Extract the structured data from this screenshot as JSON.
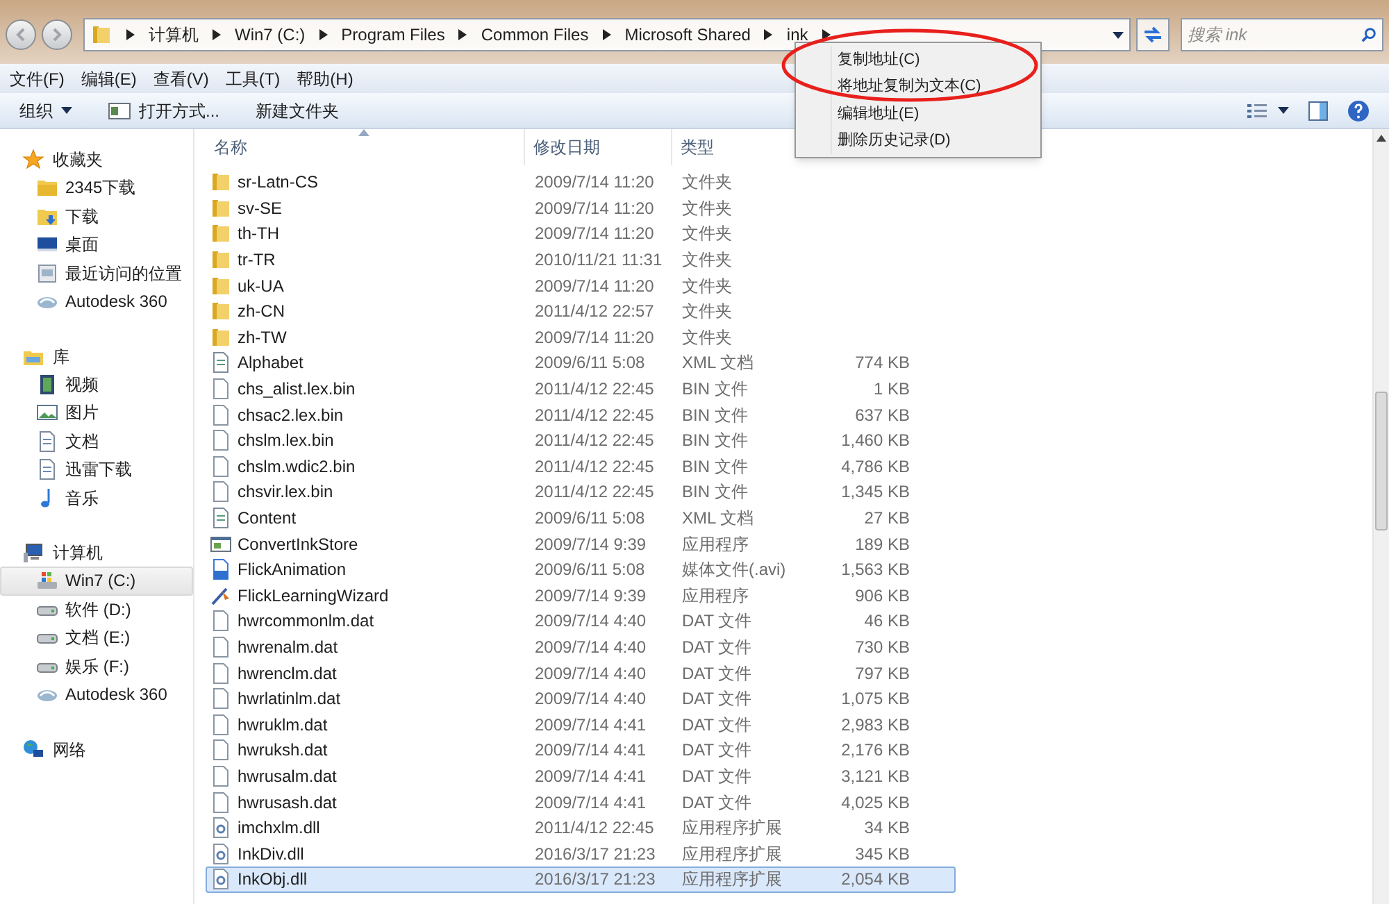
{
  "address_bar": {
    "crumbs": [
      "计算机",
      "Win7 (C:)",
      "Program Files",
      "Common Files",
      "Microsoft Shared",
      "ink"
    ]
  },
  "search": {
    "placeholder": "搜索 ink"
  },
  "menu_bar": [
    "文件(F)",
    "编辑(E)",
    "查看(V)",
    "工具(T)",
    "帮助(H)"
  ],
  "toolbar": [
    {
      "kind": "menu",
      "label": "组织"
    },
    {
      "kind": "open",
      "label": "打开方式..."
    },
    {
      "kind": "plain",
      "label": "新建文件夹"
    }
  ],
  "context_menu": {
    "highlighted": true,
    "items": [
      "复制地址(C)",
      "将地址复制为文本(C)",
      "编辑地址(E)",
      "删除历史记录(D)"
    ]
  },
  "sidebar": {
    "groups": [
      {
        "label": "收藏夹",
        "kind": "star",
        "items": [
          {
            "label": "2345下载",
            "kind": "folder",
            "selected": false
          },
          {
            "label": "下载",
            "kind": "download",
            "selected": false
          },
          {
            "label": "桌面",
            "kind": "desktop",
            "selected": false
          },
          {
            "label": "最近访问的位置",
            "kind": "recent",
            "selected": false
          },
          {
            "label": "Autodesk 360",
            "kind": "cloud",
            "selected": false
          }
        ]
      },
      {
        "label": "库",
        "kind": "library",
        "items": [
          {
            "label": "视频",
            "kind": "video",
            "selected": false
          },
          {
            "label": "图片",
            "kind": "picture",
            "selected": false
          },
          {
            "label": "文档",
            "kind": "document",
            "selected": false
          },
          {
            "label": "迅雷下载",
            "kind": "document",
            "selected": false
          },
          {
            "label": "音乐",
            "kind": "music",
            "selected": false
          }
        ]
      },
      {
        "label": "计算机",
        "kind": "computer",
        "items": [
          {
            "label": "Win7 (C:)",
            "kind": "system-drive",
            "selected": true
          },
          {
            "label": "软件 (D:)",
            "kind": "drive",
            "selected": false
          },
          {
            "label": "文档 (E:)",
            "kind": "drive",
            "selected": false
          },
          {
            "label": "娱乐 (F:)",
            "kind": "drive",
            "selected": false
          },
          {
            "label": "Autodesk 360",
            "kind": "cloud",
            "selected": false
          }
        ]
      },
      {
        "label": "网络",
        "kind": "network"
      }
    ]
  },
  "table": {
    "columns": [
      "名称",
      "修改日期",
      "类型"
    ],
    "rows": [
      {
        "kind": "folder",
        "name": "sr-Latn-CS",
        "date": "2009/7/14 11:20",
        "type": "文件夹",
        "selected": false
      },
      {
        "kind": "folder",
        "name": "sv-SE",
        "date": "2009/7/14 11:20",
        "type": "文件夹",
        "selected": false
      },
      {
        "kind": "folder",
        "name": "th-TH",
        "date": "2009/7/14 11:20",
        "type": "文件夹",
        "selected": false
      },
      {
        "kind": "folder",
        "name": "tr-TR",
        "date": "2010/11/21 11:31",
        "type": "文件夹",
        "selected": false
      },
      {
        "kind": "folder",
        "name": "uk-UA",
        "date": "2009/7/14 11:20",
        "type": "文件夹",
        "selected": false
      },
      {
        "kind": "folder",
        "name": "zh-CN",
        "date": "2011/4/12 22:57",
        "type": "文件夹",
        "selected": false
      },
      {
        "kind": "folder",
        "name": "zh-TW",
        "date": "2009/7/14 11:20",
        "type": "文件夹",
        "selected": false
      },
      {
        "kind": "xml",
        "name": "Alphabet",
        "date": "2009/6/11 5:08",
        "type": "XML 文档",
        "size": "774 KB",
        "selected": false
      },
      {
        "kind": "file",
        "name": "chs_alist.lex.bin",
        "date": "2011/4/12 22:45",
        "type": "BIN 文件",
        "size": "1 KB",
        "selected": false
      },
      {
        "kind": "file",
        "name": "chsac2.lex.bin",
        "date": "2011/4/12 22:45",
        "type": "BIN 文件",
        "size": "637 KB",
        "selected": false
      },
      {
        "kind": "file",
        "name": "chslm.lex.bin",
        "date": "2011/4/12 22:45",
        "type": "BIN 文件",
        "size": "1,460 KB",
        "selected": false
      },
      {
        "kind": "file",
        "name": "chslm.wdic2.bin",
        "date": "2011/4/12 22:45",
        "type": "BIN 文件",
        "size": "4,786 KB",
        "selected": false
      },
      {
        "kind": "file",
        "name": "chsvir.lex.bin",
        "date": "2011/4/12 22:45",
        "type": "BIN 文件",
        "size": "1,345 KB",
        "selected": false
      },
      {
        "kind": "xml",
        "name": "Content",
        "date": "2009/6/11 5:08",
        "type": "XML 文档",
        "size": "27 KB",
        "selected": false
      },
      {
        "kind": "app",
        "name": "ConvertInkStore",
        "date": "2009/7/14 9:39",
        "type": "应用程序",
        "size": "189 KB",
        "selected": false
      },
      {
        "kind": "video",
        "name": "FlickAnimation",
        "date": "2009/6/11 5:08",
        "type": "媒体文件(.avi)",
        "size": "1,563 KB",
        "selected": false
      },
      {
        "kind": "wizard",
        "name": "FlickLearningWizard",
        "date": "2009/7/14 9:39",
        "type": "应用程序",
        "size": "906 KB",
        "selected": false
      },
      {
        "kind": "file",
        "name": "hwrcommonlm.dat",
        "date": "2009/7/14 4:40",
        "type": "DAT 文件",
        "size": "46 KB",
        "selected": false
      },
      {
        "kind": "file",
        "name": "hwrenalm.dat",
        "date": "2009/7/14 4:40",
        "type": "DAT 文件",
        "size": "730 KB",
        "selected": false
      },
      {
        "kind": "file",
        "name": "hwrenclm.dat",
        "date": "2009/7/14 4:40",
        "type": "DAT 文件",
        "size": "797 KB",
        "selected": false
      },
      {
        "kind": "file",
        "name": "hwrlatinlm.dat",
        "date": "2009/7/14 4:40",
        "type": "DAT 文件",
        "size": "1,075 KB",
        "selected": false
      },
      {
        "kind": "file",
        "name": "hwruklm.dat",
        "date": "2009/7/14 4:41",
        "type": "DAT 文件",
        "size": "2,983 KB",
        "selected": false
      },
      {
        "kind": "file",
        "name": "hwruksh.dat",
        "date": "2009/7/14 4:41",
        "type": "DAT 文件",
        "size": "2,176 KB",
        "selected": false
      },
      {
        "kind": "file",
        "name": "hwrusalm.dat",
        "date": "2009/7/14 4:41",
        "type": "DAT 文件",
        "size": "3,121 KB",
        "selected": false
      },
      {
        "kind": "file",
        "name": "hwrusash.dat",
        "date": "2009/7/14 4:41",
        "type": "DAT 文件",
        "size": "4,025 KB",
        "selected": false
      },
      {
        "kind": "dll",
        "name": "imchxlm.dll",
        "date": "2011/4/12 22:45",
        "type": "应用程序扩展",
        "size": "34 KB",
        "selected": false
      },
      {
        "kind": "dll",
        "name": "InkDiv.dll",
        "date": "2016/3/17 21:23",
        "type": "应用程序扩展",
        "size": "345 KB",
        "selected": false
      },
      {
        "kind": "dll",
        "name": "InkObj.dll",
        "date": "2016/3/17 21:23",
        "type": "应用程序扩展",
        "size": "2,054 KB",
        "selected": true
      }
    ]
  }
}
